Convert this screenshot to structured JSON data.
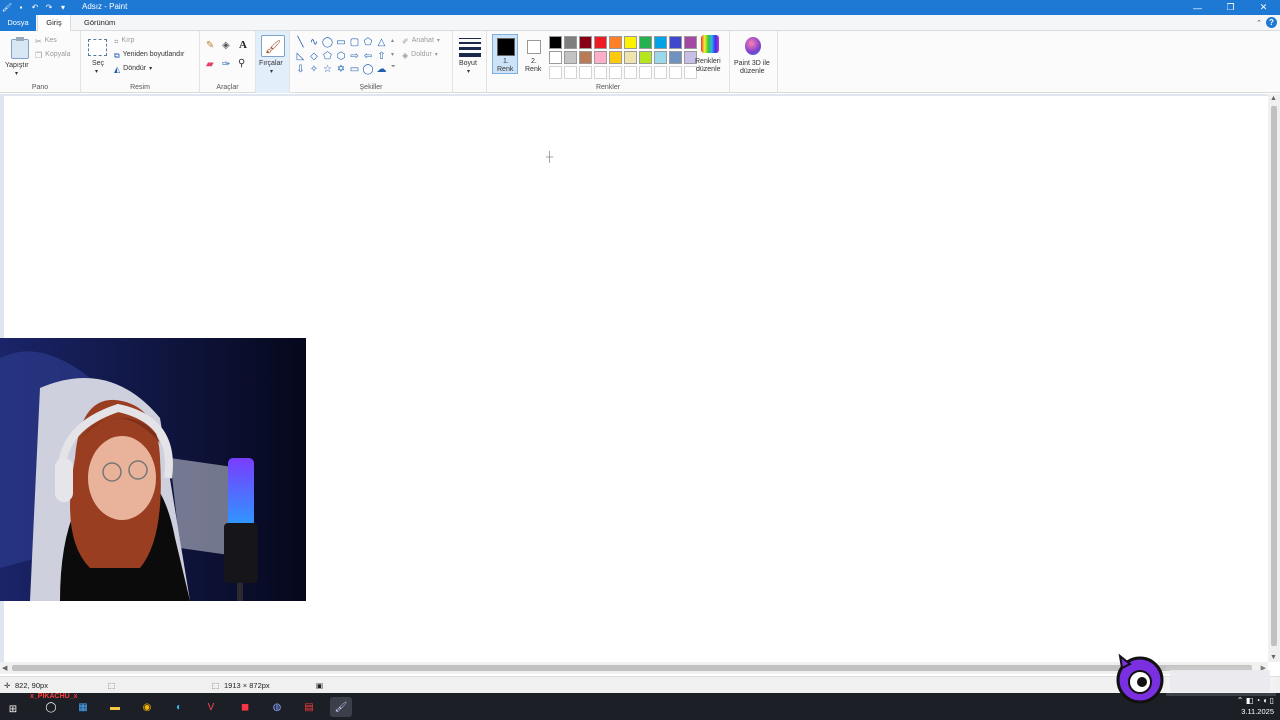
{
  "window": {
    "title": "Adsız - Paint"
  },
  "menu": {
    "tabs": [
      "Dosya",
      "Giriş",
      "Görünüm"
    ]
  },
  "ribbon": {
    "clipboard": {
      "paste": "Yapıştır",
      "cut": "Kes",
      "copy": "Kopyala",
      "group": "Pano"
    },
    "image": {
      "select": "Seç",
      "crop": "Kırp",
      "resize": "Yeniden boyutlandır",
      "rotate": "Döndür",
      "group": "Resim"
    },
    "tools": {
      "group": "Araçlar"
    },
    "brushes": {
      "label": "Fırçalar"
    },
    "shapes": {
      "outline": "Anahat",
      "fill": "Doldur",
      "group": "Şekiller"
    },
    "size": {
      "label": "Boyut"
    },
    "colors": {
      "color1": "1.\nRenk",
      "color1_a": "1.",
      "color1_b": "Renk",
      "color2_a": "2.",
      "color2_b": "Renk",
      "edit_a": "Renkleri",
      "edit_b": "düzenle",
      "paint3d_a": "Paint 3D ile",
      "paint3d_b": "düzenle",
      "group": "Renkler",
      "color1_value": "#000000",
      "color2_value": "#ffffff",
      "palette": [
        "#000000",
        "#7f7f7f",
        "#880015",
        "#ed1c24",
        "#ff7f27",
        "#fff200",
        "#22b14c",
        "#00a2e8",
        "#3f48cc",
        "#a349a4",
        "#ffffff",
        "#c3c3c3",
        "#b97a57",
        "#ffaec9",
        "#ffc90e",
        "#efe4b0",
        "#b5e61d",
        "#99d9ea",
        "#7092be",
        "#c8bfe7"
      ]
    }
  },
  "status": {
    "cursor_pos": "822, 90px",
    "canvas_size": "1913 × 872px"
  },
  "taskbar": {
    "overlay_text": "x_PIKACHU_x",
    "date": "3.11.2025"
  }
}
